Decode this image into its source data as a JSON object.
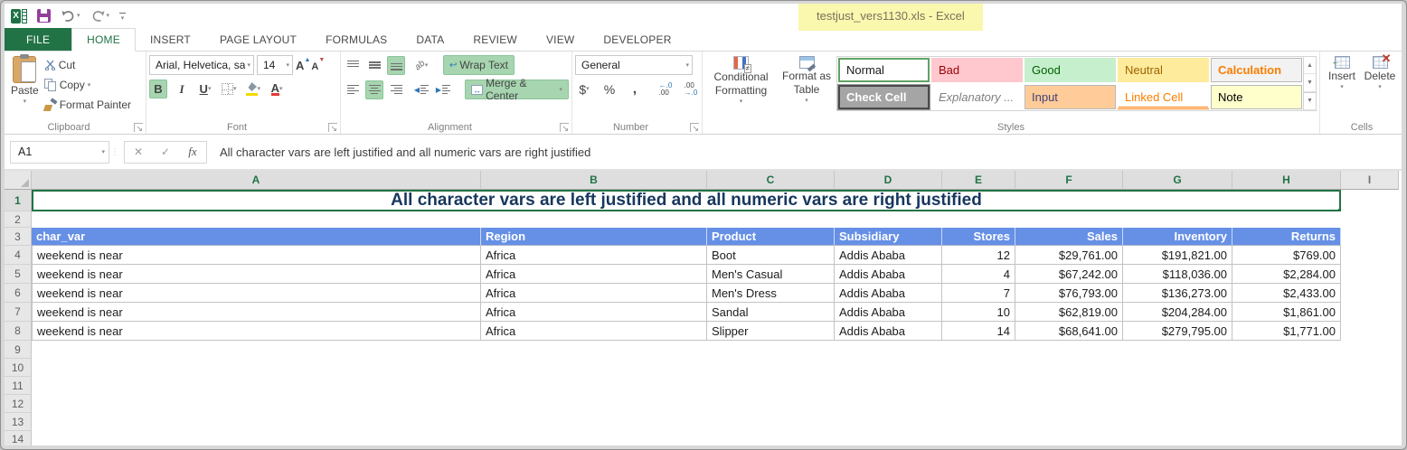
{
  "window": {
    "title": "testjust_vers1130.xls - Excel"
  },
  "glyphs": {
    "dropdown": "▾",
    "dialog_launcher": "↘",
    "up": "▲",
    "down": "▼",
    "more": "▼",
    "bold": "B",
    "italic": "I",
    "underline": "U",
    "increase_font": "A",
    "decrease_font": "A",
    "orientation": "ab",
    "dollar": "$",
    "percent": "%",
    "comma": ",",
    "inc_dec_top": "←.0",
    "inc_dec_bot": ".00",
    "dec_dec_top": ".00",
    "dec_dec_bot": "→.0",
    "cancel": "✕",
    "enter": "✓",
    "fx_label": "fx",
    "wrap_arrow": "↩",
    "excel_logo_letter": "X",
    "scissors": "✂",
    "delete_x": "✕",
    "insert_arrow": "←"
  },
  "tabs": [
    {
      "label": "FILE",
      "type": "file"
    },
    {
      "label": "HOME",
      "active": true
    },
    {
      "label": "INSERT"
    },
    {
      "label": "PAGE LAYOUT"
    },
    {
      "label": "FORMULAS"
    },
    {
      "label": "DATA"
    },
    {
      "label": "REVIEW"
    },
    {
      "label": "VIEW"
    },
    {
      "label": "DEVELOPER"
    }
  ],
  "ribbon": {
    "clipboard": {
      "label": "Clipboard",
      "paste": "Paste",
      "cut": "Cut",
      "copy": "Copy",
      "format_painter": "Format Painter"
    },
    "font": {
      "label": "Font",
      "family": "Arial, Helvetica, sa",
      "size": "14"
    },
    "alignment": {
      "label": "Alignment",
      "wrap_text": "Wrap Text",
      "merge_center": "Merge & Center"
    },
    "number": {
      "label": "Number",
      "format": "General"
    },
    "styles": {
      "label": "Styles",
      "conditional_line1": "Conditional",
      "conditional_line2": "Formatting",
      "format_table_line1": "Format as",
      "format_table_line2": "Table",
      "gallery": [
        [
          {
            "name": "Normal",
            "bg": "#FFFFFF",
            "fg": "#1A1A1A",
            "selected": true
          },
          {
            "name": "Bad",
            "bg": "#FFC7CE",
            "fg": "#9C0006"
          },
          {
            "name": "Good",
            "bg": "#C6EFCE",
            "fg": "#006100"
          },
          {
            "name": "Neutral",
            "bg": "#FFEB9C",
            "fg": "#9C6500"
          },
          {
            "name": "Calculation",
            "bg": "#F2F2F2",
            "fg": "#FA7D00",
            "bold": true,
            "boxed": true
          }
        ],
        [
          {
            "name": "Check Cell",
            "bg": "#A5A5A5",
            "fg": "#FFFFFF",
            "bold": true,
            "thick": true
          },
          {
            "name": "Explanatory ...",
            "bg": "#FFFFFF",
            "fg": "#7F7F7F",
            "italic": true
          },
          {
            "name": "Input",
            "bg": "#FFCC99",
            "fg": "#3F3F76",
            "boxed": true
          },
          {
            "name": "Linked Cell",
            "bg": "#FFFFFF",
            "fg": "#FA7D00",
            "underline": true
          },
          {
            "name": "Note",
            "bg": "#FFFFCC",
            "fg": "#000000",
            "boxed": true
          }
        ]
      ]
    },
    "cells": {
      "label": "Cells",
      "insert": "Insert",
      "delete": "Delete"
    }
  },
  "formula_bar": {
    "name_box": "A1",
    "formula": "All character vars are left justified and all numeric vars are right justified"
  },
  "grid": {
    "columns": [
      {
        "letter": "A",
        "selected": true
      },
      {
        "letter": "B",
        "selected": true
      },
      {
        "letter": "C",
        "selected": true
      },
      {
        "letter": "D",
        "selected": true
      },
      {
        "letter": "E",
        "selected": true
      },
      {
        "letter": "F",
        "selected": true
      },
      {
        "letter": "G",
        "selected": true
      },
      {
        "letter": "H",
        "selected": true
      },
      {
        "letter": "I",
        "selected": false
      }
    ],
    "row_numbers": [
      "1",
      "2",
      "3",
      "4",
      "5",
      "6",
      "7",
      "8",
      "9",
      "10",
      "11",
      "12",
      "13",
      "14"
    ],
    "selected_row": "1",
    "title_row": {
      "text": "All character vars are left justified and all numeric vars are right justified",
      "color": "#17375E"
    },
    "table": {
      "header_bg": "#6690E6",
      "header_fg": "#FFFFFF",
      "headers": [
        {
          "label": "char_var",
          "align": "left"
        },
        {
          "label": "Region",
          "align": "left"
        },
        {
          "label": "Product",
          "align": "left"
        },
        {
          "label": "Subsidiary",
          "align": "left"
        },
        {
          "label": "Stores",
          "align": "right"
        },
        {
          "label": "Sales",
          "align": "right"
        },
        {
          "label": "Inventory",
          "align": "right"
        },
        {
          "label": "Returns",
          "align": "right"
        }
      ],
      "rows": [
        [
          "weekend is near",
          "Africa",
          "Boot",
          "Addis Ababa",
          "12",
          "$29,761.00",
          "$191,821.00",
          "$769.00"
        ],
        [
          "weekend is near",
          "Africa",
          "Men's Casual",
          "Addis Ababa",
          "4",
          "$67,242.00",
          "$118,036.00",
          "$2,284.00"
        ],
        [
          "weekend is near",
          "Africa",
          "Men's Dress",
          "Addis Ababa",
          "7",
          "$76,793.00",
          "$136,273.00",
          "$2,433.00"
        ],
        [
          "weekend is near",
          "Africa",
          "Sandal",
          "Addis Ababa",
          "10",
          "$62,819.00",
          "$204,284.00",
          "$1,861.00"
        ],
        [
          "weekend is near",
          "Africa",
          "Slipper",
          "Addis Ababa",
          "14",
          "$68,641.00",
          "$279,795.00",
          "$1,771.00"
        ]
      ]
    },
    "colors": {
      "selection_border": "#217346"
    }
  }
}
